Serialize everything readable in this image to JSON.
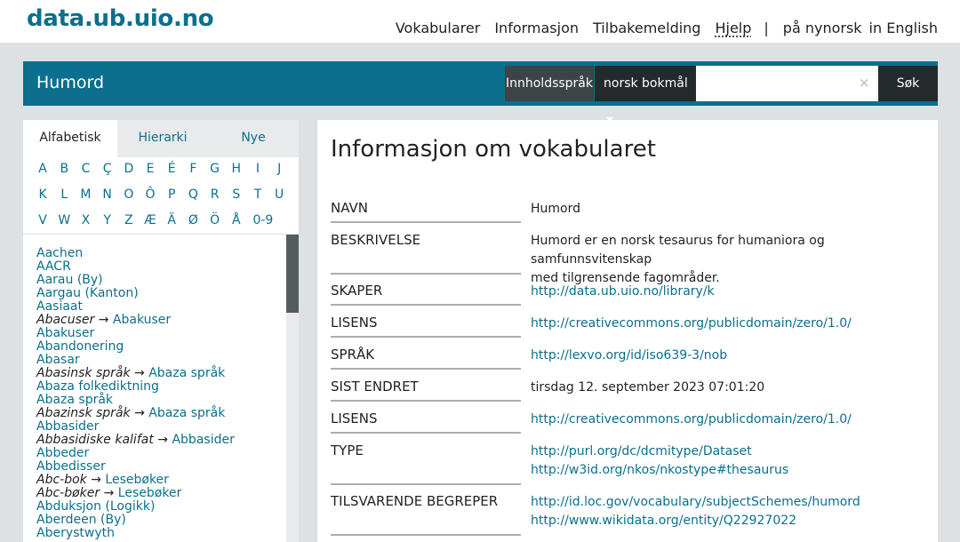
{
  "header": {
    "logo": "data.ub.uio.no",
    "nav": [
      "Vokabularer",
      "Informasjon",
      "Tilbakemelding",
      "Hjelp"
    ],
    "separator": "|",
    "languages": [
      "på nynorsk",
      "in English"
    ]
  },
  "vocab_bar": {
    "title": "Humord",
    "content_language_label": "Innholdsspråk",
    "language_selected": "norsk bokmål",
    "search_placeholder": "",
    "search_value": "",
    "clear_symbol": "×",
    "search_button": "Søk"
  },
  "sidebar": {
    "tabs": [
      "Alfabetisk",
      "Hierarki",
      "Nye"
    ],
    "active_tab": "Alfabetisk",
    "letters_row1": [
      "A",
      "B",
      "C",
      "Ç",
      "D",
      "E",
      "É",
      "F",
      "G",
      "H",
      "I",
      "J"
    ],
    "letters_row2": [
      "K",
      "L",
      "M",
      "N",
      "O",
      "Ô",
      "P",
      "Q",
      "R",
      "S",
      "T",
      "U"
    ],
    "letters_row3": [
      "V",
      "W",
      "X",
      "Y",
      "Z",
      "Æ",
      "Ä",
      "Ø",
      "Ö",
      "Å",
      "0-9"
    ],
    "terms": [
      {
        "text": "Aachen"
      },
      {
        "text": "AACR"
      },
      {
        "text": "Aarau (By)"
      },
      {
        "text": "Aargau (Kanton)"
      },
      {
        "text": "Aasiaat"
      },
      {
        "alt": "Abacuser",
        "text": "Abakuser"
      },
      {
        "text": "Abakuser"
      },
      {
        "text": "Abandonering"
      },
      {
        "text": "Abasar"
      },
      {
        "alt": "Abasinsk språk",
        "text": "Abaza språk"
      },
      {
        "text": "Abaza folkediktning"
      },
      {
        "text": "Abaza språk"
      },
      {
        "alt": "Abazinsk språk",
        "text": "Abaza språk"
      },
      {
        "text": "Abbasider"
      },
      {
        "alt": "Abbasidiske kalifat",
        "text": "Abbasider"
      },
      {
        "text": "Abbeder"
      },
      {
        "text": "Abbedisser"
      },
      {
        "alt": "Abc-bok",
        "text": "Lesebøker"
      },
      {
        "alt": "Abc-bøker",
        "text": "Lesebøker"
      },
      {
        "text": "Abduksjon (Logikk)"
      },
      {
        "text": "Aberdeen (By)"
      },
      {
        "text": "Aberystwyth"
      }
    ],
    "arrow_symbol": "→"
  },
  "main": {
    "title": "Informasjon om vokabularet",
    "properties": [
      {
        "label": "NAVN",
        "values": [
          "Humord"
        ],
        "link": false
      },
      {
        "label": "BESKRIVELSE",
        "values": [
          "Humord er en norsk tesaurus for humaniora og samfunnsvitenskap",
          "med tilgrensende fagområder."
        ],
        "link": false
      },
      {
        "label": "SKAPER",
        "values": [
          "http://data.ub.uio.no/library/k"
        ],
        "link": true
      },
      {
        "label": "LISENS",
        "values": [
          "http://creativecommons.org/publicdomain/zero/1.0/"
        ],
        "link": true
      },
      {
        "label": "SPRÅK",
        "values": [
          "http://lexvo.org/id/iso639-3/nob"
        ],
        "link": true
      },
      {
        "label": "SIST ENDRET",
        "values": [
          "tirsdag 12. september 2023 07:01:20"
        ],
        "link": false
      },
      {
        "label": "LISENS",
        "values": [
          "http://creativecommons.org/publicdomain/zero/1.0/"
        ],
        "link": true
      },
      {
        "label": "TYPE",
        "values": [
          "http://purl.org/dc/dcmitype/Dataset",
          "http://w3id.org/nkos/nkostype#thesaurus"
        ],
        "link": true
      },
      {
        "label": "TILSVARENDE BEGREPER",
        "values": [
          "http://id.loc.gov/vocabulary/subjectSchemes/humord",
          "http://www.wikidata.org/entity/Q22927022"
        ],
        "link": true
      }
    ]
  },
  "colors": {
    "brand": "#0b6f8d",
    "page_bg": "#dde1e3",
    "dark_control": "#24292b"
  }
}
